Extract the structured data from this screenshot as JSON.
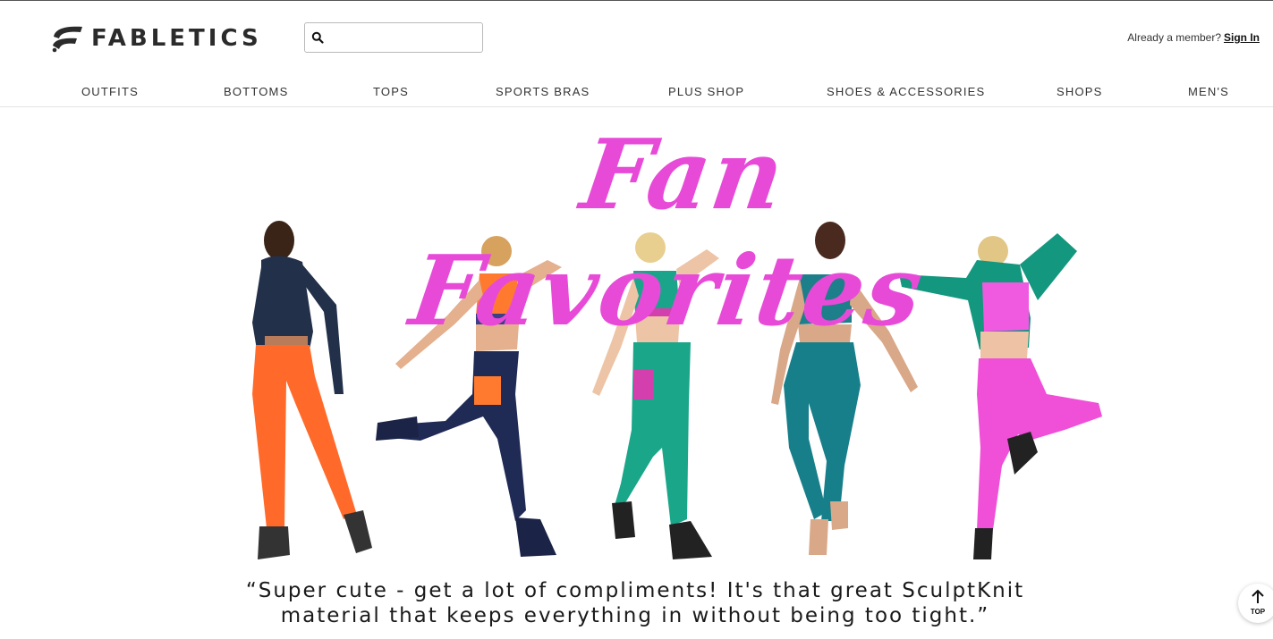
{
  "header": {
    "brand": "FABLETICS",
    "search_placeholder": "",
    "member_prompt": "Already a member?",
    "sign_in": "Sign In"
  },
  "nav": {
    "items": [
      "OUTFITS",
      "BOTTOMS",
      "TOPS",
      "SPORTS BRAS",
      "PLUS SHOP",
      "SHOES & ACCESSORIES",
      "SHOPS",
      "MEN'S"
    ]
  },
  "hero": {
    "title": "Fan Favorites",
    "quote_line1": "“Super cute - get a lot of compliments! It's that great SculptKnit",
    "quote_line2": "material that keeps everything in without being too tight.”"
  },
  "top_button": {
    "label": "TOP"
  },
  "colors": {
    "accent_pink": "#e84ad8",
    "orange": "#ff6a2b",
    "navy": "#1f2a55",
    "green": "#1aa58a",
    "teal": "#177f8a",
    "magenta": "#f04fd8"
  }
}
